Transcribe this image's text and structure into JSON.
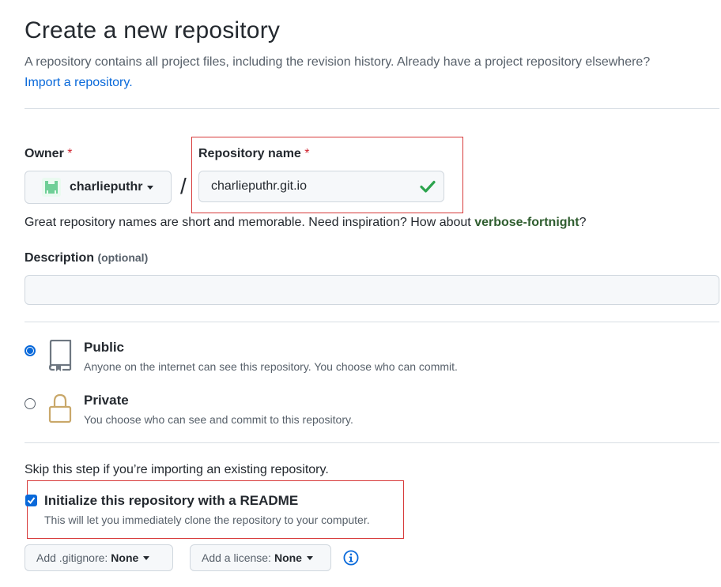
{
  "header": {
    "title": "Create a new repository",
    "subtitle": "A repository contains all project files, including the revision history. Already have a project repository elsewhere?",
    "import_link": "Import a repository."
  },
  "owner": {
    "label": "Owner",
    "required_mark": "*",
    "value": "charlieputhr"
  },
  "separator": "/",
  "repo_name": {
    "label": "Repository name",
    "required_mark": "*",
    "value": "charlieputhr.git.io"
  },
  "hint": {
    "text": "Great repository names are short and memorable. Need inspiration? How about",
    "suggestion": "verbose-fortnight",
    "end": "?"
  },
  "description": {
    "label": "Description",
    "optional": "(optional)",
    "value": ""
  },
  "visibility": {
    "selected": "public",
    "public": {
      "title": "Public",
      "desc": "Anyone on the internet can see this repository. You choose who can commit."
    },
    "private": {
      "title": "Private",
      "desc": "You choose who can see and commit to this repository."
    }
  },
  "init": {
    "skip_text": "Skip this step if you’re importing an existing repository.",
    "readme_label": "Initialize this repository with a README",
    "readme_desc": "This will let you immediately clone the repository to your computer.",
    "readme_checked": true
  },
  "gitignore": {
    "label": "Add .gitignore:",
    "value": "None"
  },
  "license": {
    "label": "Add a license:",
    "value": "None"
  },
  "colors": {
    "link": "#0969da",
    "required": "#cf222e",
    "success": "#2da44e",
    "highlight_box": "#d73a3a"
  }
}
